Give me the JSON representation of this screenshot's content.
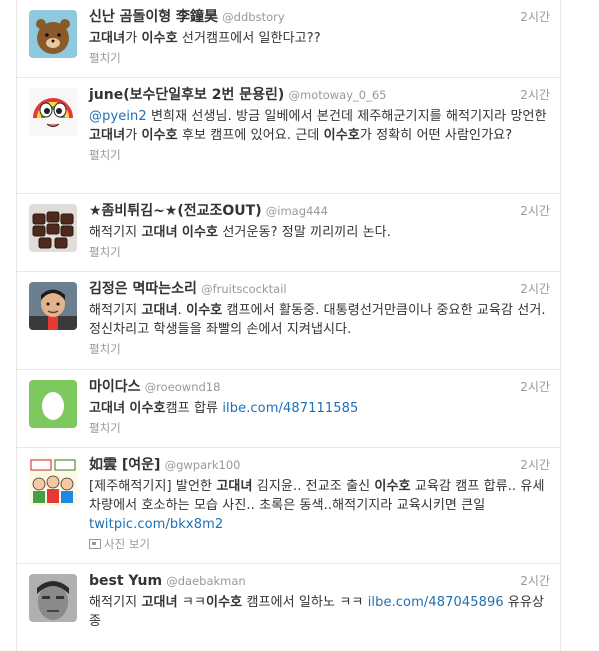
{
  "tweets": [
    {
      "name": "신난 곰돌이형 李鐘昊",
      "handle": "@ddbstory",
      "time": "2시간",
      "segments": [
        {
          "t": "고대녀",
          "s": "kw"
        },
        {
          "t": "가 ",
          "s": ""
        },
        {
          "t": "이수호",
          "s": "kw"
        },
        {
          "t": " 선거캠프에서 일한다고??",
          "s": ""
        }
      ],
      "action": "펼치기",
      "avatar": "brown-bear-icon"
    },
    {
      "name": "june(보수단일후보 2번 문용린)",
      "handle": "@motoway_0_65",
      "time": "2시간",
      "segments": [
        {
          "t": "@pyein2",
          "s": "link"
        },
        {
          "t": " 변희재 선생님. 방금 일베에서 본건데 제주해군기지를 해적기지라 망언한 ",
          "s": ""
        },
        {
          "t": "고대녀",
          "s": "kw"
        },
        {
          "t": "가 ",
          "s": ""
        },
        {
          "t": "이수호",
          "s": "kw"
        },
        {
          "t": " 후보 캠프에 있어요. 근데 ",
          "s": ""
        },
        {
          "t": "이수호",
          "s": "kw"
        },
        {
          "t": "가 정확히 어떤 사람인가요?",
          "s": ""
        }
      ],
      "action": "펼치기",
      "avatar": "rainbow-cartoon-icon"
    },
    {
      "name": "★좀비튀김~★(전교조OUT)",
      "handle": "@imag444",
      "time": "2시간",
      "segments": [
        {
          "t": "해적기지 ",
          "s": ""
        },
        {
          "t": "고대녀",
          "s": "kw"
        },
        {
          "t": " ",
          "s": ""
        },
        {
          "t": "이수호",
          "s": "kw"
        },
        {
          "t": " 선거운동? 정말 끼리끼리 논다.",
          "s": ""
        }
      ],
      "action": "펼치기",
      "avatar": "chocolate-bar-icon"
    },
    {
      "name": "김정은 멱따는소리",
      "handle": "@fruitscocktail",
      "time": "2시간",
      "segments": [
        {
          "t": "해적기지 ",
          "s": ""
        },
        {
          "t": "고대녀",
          "s": "kw"
        },
        {
          "t": ". ",
          "s": ""
        },
        {
          "t": "이수호",
          "s": "kw"
        },
        {
          "t": " 캠프에서 활동중. 대통령선거만큼이나 중요한 교육감 선거. 정신차리고 학생들을 좌빨의 손에서 지켜냅시다.",
          "s": ""
        }
      ],
      "action": "펼치기",
      "avatar": "person-photo-icon"
    },
    {
      "name": "마이다스",
      "handle": "@roeownd18",
      "time": "2시간",
      "segments": [
        {
          "t": "고대녀",
          "s": "kw"
        },
        {
          "t": " ",
          "s": ""
        },
        {
          "t": "이수호",
          "s": "kw"
        },
        {
          "t": "캠프 합류 ",
          "s": ""
        },
        {
          "t": "ilbe.com/487111585",
          "s": "link"
        }
      ],
      "action": "펼치기",
      "avatar": "default-egg-icon"
    },
    {
      "name": "如雲 [여운]",
      "handle": "@gwpark100",
      "time": "2시간",
      "segments": [
        {
          "t": "[제주해적기지] 발언한 ",
          "s": ""
        },
        {
          "t": "고대녀",
          "s": "kw"
        },
        {
          "t": " 김지윤.. 전교조 출신 ",
          "s": ""
        },
        {
          "t": "이수호",
          "s": "kw"
        },
        {
          "t": " 교육감 캠프 합류.. 유세차량에서 호소하는 모습 사진.. 초록은 동색..해적기지라 교육시키면 큰일 ",
          "s": ""
        },
        {
          "t": "twitpic.com/bkx8m2",
          "s": "link"
        }
      ],
      "action": "사진 보기",
      "avatar": "cartoon-group-icon"
    },
    {
      "name": "best Yum",
      "handle": "@daebakman",
      "time": "2시간",
      "segments": [
        {
          "t": "해적기지 ",
          "s": ""
        },
        {
          "t": "고대녀",
          "s": "kw"
        },
        {
          "t": " ㅋㅋ",
          "s": ""
        },
        {
          "t": "이수호",
          "s": "kw"
        },
        {
          "t": " 캠프에서 일하노 ㅋㅋ ",
          "s": ""
        },
        {
          "t": "ilbe.com/487045896",
          "s": "link"
        },
        {
          "t": " 유유상종",
          "s": ""
        }
      ],
      "action": "",
      "avatar": "grayscale-face-icon"
    }
  ],
  "colors": {
    "link": "#1f6fb5",
    "muted": "#999999",
    "text": "#333333",
    "divider": "#e8e8e8"
  }
}
